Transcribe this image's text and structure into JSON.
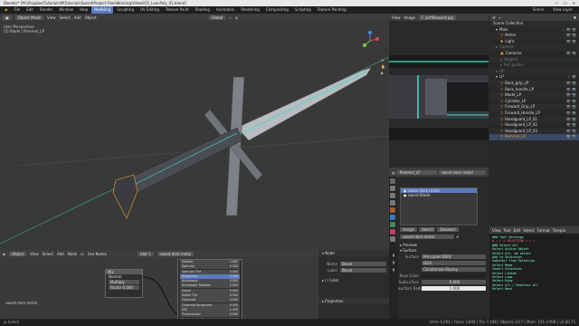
{
  "window": {
    "title": "Blender* [M:\\Dropbox\\Tutorials\\M\\Tutorials\\Sword\\Project Files\\Working\\Video015_Low-Poly_01.blend]",
    "controls": [
      "—",
      "☐",
      "✕"
    ]
  },
  "menubar": {
    "menus": [
      "File",
      "Edit",
      "Render",
      "Window",
      "Help"
    ],
    "workspaces": [
      "Modeling",
      "Sculpting",
      "UV Editing",
      "Texture Paint",
      "Shading",
      "Animation",
      "Rendering",
      "Compositing",
      "Scripting",
      "Texture Painting"
    ],
    "active_workspace": "Modeling",
    "scene": "Scene",
    "view_layer": "View Layer"
  },
  "viewport": {
    "mode": "Object Mode",
    "menus": [
      "View",
      "Select",
      "Add",
      "Object"
    ],
    "transform": "Global",
    "info_line1": "User Perspective",
    "info_line2": "(3) Blade | Pommel_LP"
  },
  "image_editor": {
    "menus": [
      "View",
      "Image"
    ],
    "image_name": "F_bcf08sword.jpg"
  },
  "outliner": {
    "header": "Scene Collection",
    "rows": [
      {
        "label": "Scene Collection",
        "indent": 0,
        "color": "#ddd"
      },
      {
        "label": "Main",
        "indent": 1,
        "color": "#ddd"
      },
      {
        "label": "Armor",
        "indent": 2,
        "color": "#ddd"
      },
      {
        "label": "Light",
        "indent": 2,
        "color": "#ddd"
      },
      {
        "label": "Camera",
        "indent": 1,
        "color": "#777"
      },
      {
        "label": "Cameras",
        "indent": 2,
        "color": "#ddd"
      },
      {
        "label": "Helpers",
        "indent": 2,
        "color": "#777"
      },
      {
        "label": "Ref_guides",
        "indent": 2,
        "color": "#777"
      },
      {
        "label": "HP",
        "indent": 1,
        "color": "#777"
      },
      {
        "label": "LP",
        "indent": 1,
        "color": "#ddd"
      },
      {
        "label": "Back_grip_LP",
        "indent": 2,
        "color": "#ddd"
      },
      {
        "label": "Back_handle_LP",
        "indent": 2,
        "color": "#ddd"
      },
      {
        "label": "Blade_LP",
        "indent": 2,
        "color": "#ddd"
      },
      {
        "label": "Cylinder_LP",
        "indent": 2,
        "color": "#ddd"
      },
      {
        "label": "Forward_Grip_LP",
        "indent": 2,
        "color": "#ddd"
      },
      {
        "label": "Forward_Handle_LP",
        "indent": 2,
        "color": "#ddd"
      },
      {
        "label": "Handguard_LP_01",
        "indent": 2,
        "color": "#ddd"
      },
      {
        "label": "Handguard_LP_02",
        "indent": 2,
        "color": "#ddd"
      },
      {
        "label": "Handguard_LP_03",
        "indent": 2,
        "color": "#ddd"
      },
      {
        "label": "Pommel_LP",
        "indent": 2,
        "color": "#f0a030"
      }
    ]
  },
  "properties": {
    "object_name": "Pommel_LP",
    "material_name": "sword dark metal",
    "slots": [
      "sword dark metal",
      "sword Blade"
    ],
    "selected_slot": 0,
    "buttons": [
      "Assign",
      "Select",
      "Deselect"
    ],
    "data_label": "sword dark metal",
    "sections": [
      "Preview",
      "Surface"
    ],
    "surface_label": "Surface",
    "surface_value": "Principled BSDF",
    "distribution": "GGX",
    "subsurface_method": "Christensen-Burley",
    "base_color_label": "Base Color",
    "subsurface_label": "Subsurface",
    "subsurface_value": "0.000",
    "subsurface_radius_label": "Subsurface Radius",
    "subsurface_radius_value": "1.000"
  },
  "text_editor": {
    "menus": [
      "View",
      "Text",
      "Edit",
      "Select",
      "Format",
      "Templa"
    ],
    "lines": [
      "### Tool Settings",
      "",
      "# = = = SELECTION = = =",
      "### Select All",
      "Select Active Object",
      "Select all, de select",
      "Add to Selection",
      "Subtract from Selection",
      "Select Mode",
      "Invert Selection",
      "Select Linked",
      "Select Loop",
      "Select Ring",
      "Select All / Deselect All",
      "Select Next"
    ]
  },
  "node_editor": {
    "menus": [
      "Object",
      "View",
      "Select",
      "Add",
      "Node",
      "Use Nodes"
    ],
    "slot": "Slot 1",
    "material": "sword dark metal",
    "node_title": "Mix",
    "node_rows": [
      "Normal",
      "Multiply",
      "Factor 0.000"
    ],
    "label": "sword dark metal",
    "bsdf_rows": [
      "Metallic",
      "Specular",
      "Specular Tint",
      "Roughness",
      "Anisotropic",
      "Anisotropic Rotation",
      "Sheen",
      "Sheen Tint",
      "Clearcoat",
      "Clearcoat Roughness",
      "IOR",
      "Transmission",
      "Transmission Roughness"
    ],
    "bsdf_values": [
      "1.000",
      "0.500",
      "0.000",
      "0.350",
      "0.000",
      "0.000",
      "0.000",
      "0.500",
      "0.000",
      "0.030",
      "1.450",
      "0.000",
      "0.000"
    ]
  },
  "side_panel": {
    "header": "Node",
    "name_label": "Name",
    "name_value": "Bevel",
    "label_label": "Label",
    "label_value": "Bevel",
    "color_label": "Color",
    "properties_label": "Properties"
  },
  "statusbar": {
    "left": "Select",
    "right": "Verts 4,264 | Faces 3,808 | Tris 7,448 | Objects 1/17 | Mem: 101.4 MiB | v2.80.75"
  },
  "colors": {
    "accent": "#5a7bbf",
    "selected": "#f0a030",
    "blade_glow": "#38e0d0"
  }
}
